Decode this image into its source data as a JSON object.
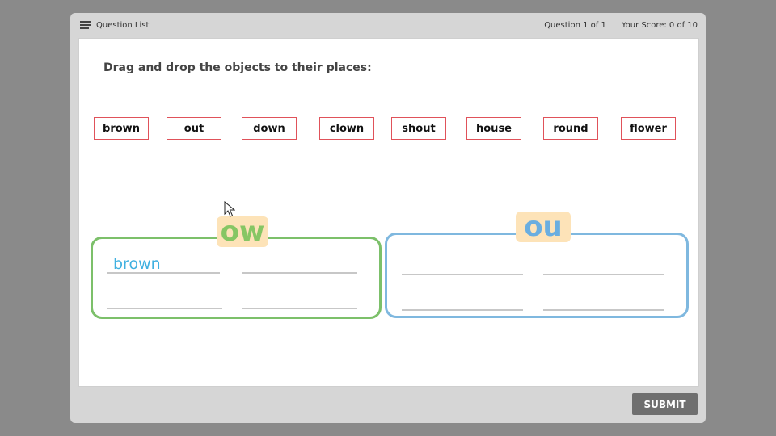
{
  "topbar": {
    "question_list_label": "Question List",
    "question_counter": "Question 1 of 1",
    "score": "Your Score: 0 of 10"
  },
  "question": {
    "prompt": "Drag and drop the objects to their places:",
    "words": [
      "brown",
      "out",
      "down",
      "clown",
      "shout",
      "house",
      "round",
      "flower"
    ]
  },
  "targets": [
    {
      "label": "ow",
      "color": "#86c664",
      "slots": [
        "brown",
        "",
        "",
        ""
      ]
    },
    {
      "label": "ou",
      "color": "#6aaee0",
      "slots": [
        "",
        "",
        "",
        ""
      ]
    }
  ],
  "footer": {
    "submit_label": "SUBMIT"
  },
  "colors": {
    "background": "#8a8a8a",
    "frame": "#d6d6d6",
    "word_border": "#e0525a",
    "ow_border": "#7cc06a",
    "ou_border": "#7fb8df",
    "tag_bg": "#fde3b8",
    "placed_text": "#3fb0e0",
    "submit_bg": "#6f6f6f"
  },
  "icons": [
    "list-icon",
    "mouse-pointer-icon"
  ]
}
